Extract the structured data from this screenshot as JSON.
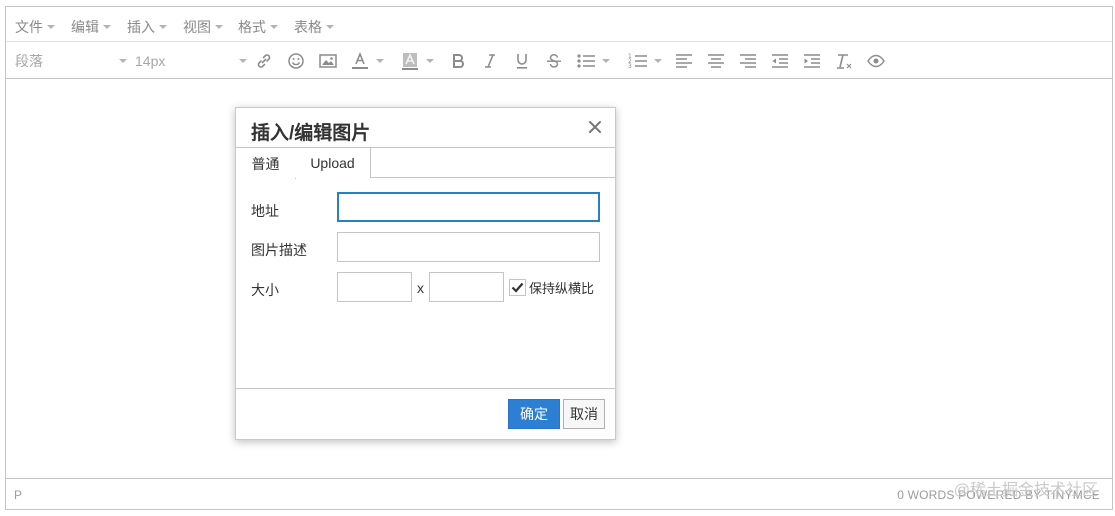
{
  "menubar": {
    "items": [
      {
        "label": "文件"
      },
      {
        "label": "编辑"
      },
      {
        "label": "插入"
      },
      {
        "label": "视图"
      },
      {
        "label": "格式"
      },
      {
        "label": "表格"
      }
    ]
  },
  "toolbar": {
    "block_format": "段落",
    "font_size": "14px",
    "icons": [
      "link-icon",
      "emoji-icon",
      "image-icon",
      "text-color-icon",
      "background-color-icon",
      "bold-icon",
      "italic-icon",
      "underline-icon",
      "strikethrough-icon",
      "bullet-list-icon",
      "numbered-list-icon",
      "align-left-icon",
      "align-center-icon",
      "align-right-icon",
      "outdent-icon",
      "indent-icon",
      "clear-format-icon",
      "preview-icon"
    ]
  },
  "dialog": {
    "title": "插入/编辑图片",
    "tabs": [
      {
        "label": "普通",
        "active": true
      },
      {
        "label": "Upload",
        "active": false
      }
    ],
    "source_label": "地址",
    "source_value": "",
    "description_label": "图片描述",
    "description_value": "",
    "size_label": "大小",
    "width_value": "",
    "height_value": "",
    "size_separator": "x",
    "constrain_label": "保持纵横比",
    "constrain_checked": true,
    "ok_label": "确定",
    "cancel_label": "取消"
  },
  "statusbar": {
    "path": "P",
    "word_count": "0 WORDS POWERED BY TINYMCE",
    "watermark": "@稀土掘金技术社区"
  },
  "colors": {
    "primary": "#2d7fd3",
    "focus_border": "#2a7fc4",
    "border": "#c5c5c5"
  }
}
